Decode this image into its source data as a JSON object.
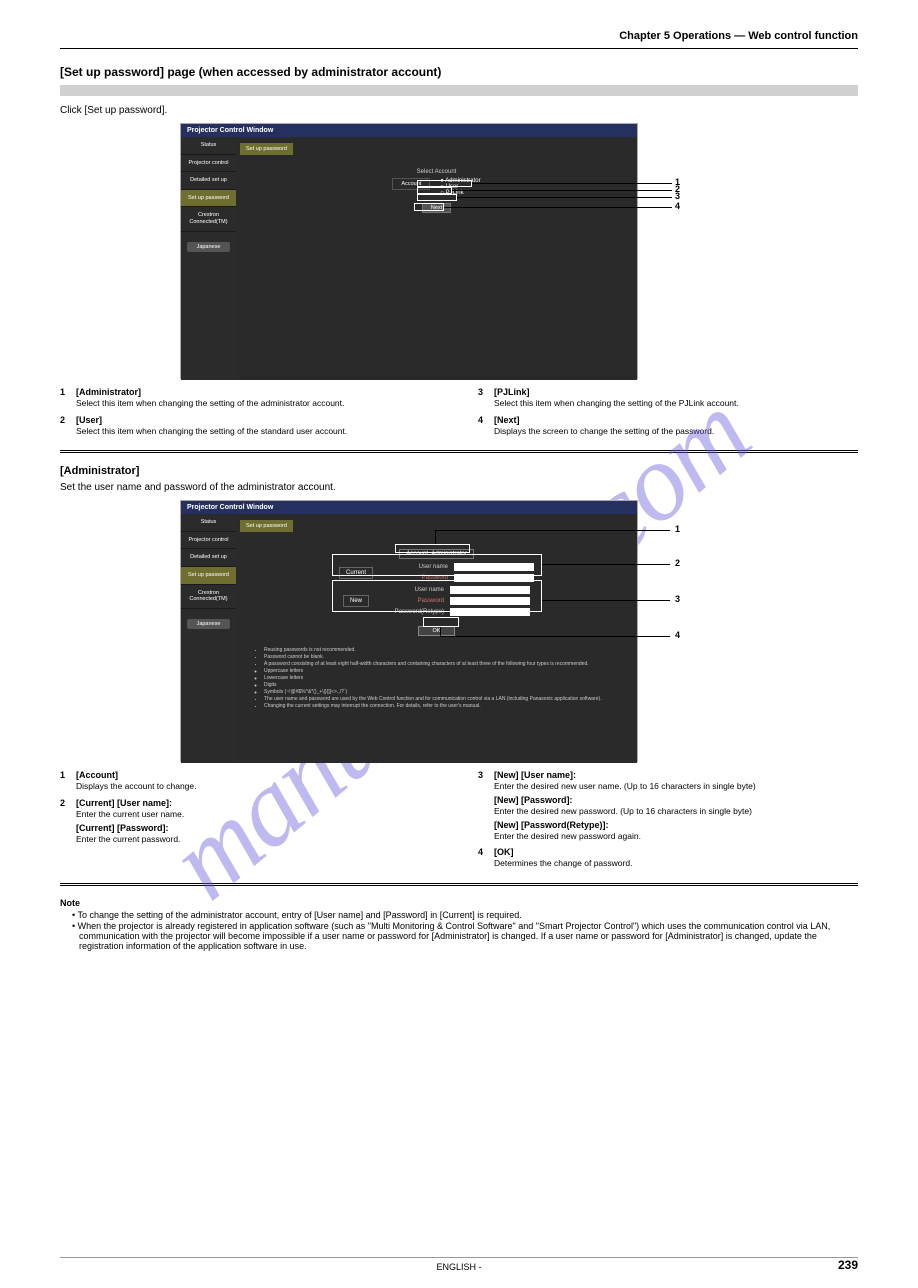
{
  "chapter": "Chapter 5 Operations — Web control function",
  "sec1": {
    "title": "[Set up password] page (when accessed by administrator account)",
    "body": "Click [Set up password]."
  },
  "shot1": {
    "title": "Projector Control Window",
    "side": [
      "Status",
      "Projector control",
      "Detailed set up",
      "Set up password",
      "Crestron Connected(TM)"
    ],
    "lang": "Japanese",
    "tab": "Set up password",
    "select_label": "Select Account",
    "account_label": "Account",
    "r1": "Administrator",
    "r2": "User",
    "r3": "PJLink",
    "next": "Next"
  },
  "callouts1": [
    {
      "n": "1",
      "t": "[Administrator]",
      "d": "Select this item when changing the setting of the administrator account."
    },
    {
      "n": "2",
      "t": "[User]",
      "d": "Select this item when changing the setting of the standard user account."
    },
    {
      "n": "3",
      "t": "[PJLink]",
      "d": "Select this item when changing the setting of the PJLink account."
    },
    {
      "n": "4",
      "t": "[Next]",
      "d": "Displays the screen to change the setting of the password."
    }
  ],
  "sec2": {
    "title": "[Administrator]",
    "body": "Set the user name and password of the administrator account."
  },
  "shot2": {
    "title": "Projector Control Window",
    "tab": "Set up password",
    "account_row_l": "Account",
    "account_row_v": "Administrator",
    "current": "Current",
    "new": "New",
    "user": "User name",
    "pass": "Password",
    "pass2": "Password(Retype)",
    "ok": "OK",
    "notes": [
      "Reusing passwords is not recommended.",
      "Password cannot be blank.",
      "A password consisting of at least eight half-width characters and containing characters of at least three of the following four types is recommended.",
      "Uppercase letters",
      "Lowercase letters",
      "Digits",
      "Symbols (~!@#$%^&*()_+\\|}{][<>.,/?`)",
      "The user name and password are used by the Web Control function and for communication control via a LAN (including Panasonic application software).",
      "Changing the current settings may interrupt the connection. For details, refer to the user's manual."
    ]
  },
  "callouts2": [
    {
      "n": "1",
      "t": "[Account]",
      "d": "Displays the account to change."
    },
    {
      "n": "2",
      "t": "[Current] [User name]:",
      "d": "Enter the current user name.",
      "t2": "[Current] [Password]:",
      "d2": "Enter the current password."
    },
    {
      "n": "3",
      "t": "[New] [User name]:",
      "d": "Enter the desired new user name. (Up to 16 characters in single byte)",
      "t2": "[New] [Password]:",
      "d2": "Enter the desired new password. (Up to 16 characters in single byte)",
      "t3": "[New] [Password(Retype)]:",
      "d3": "Enter the desired new password again."
    },
    {
      "n": "4",
      "t": "[OK]",
      "d": "Determines the change of password."
    }
  ],
  "note": {
    "head": "Note",
    "items": [
      "To change the setting of the administrator account, entry of [User name] and [Password] in [Current] is required.",
      "When the projector is already registered in application software (such as \"Multi Monitoring & Control Software\" and \"Smart Projector Control\") which uses the communication control via LAN, communication with the projector will become impossible if a user name or password for [Administrator] is changed. If a user name or password for [Administrator] is changed, update the registration information of the application software in use."
    ]
  },
  "footer": {
    "text": "ENGLISH - ",
    "page": "239"
  },
  "watermark": "manualslive.com"
}
